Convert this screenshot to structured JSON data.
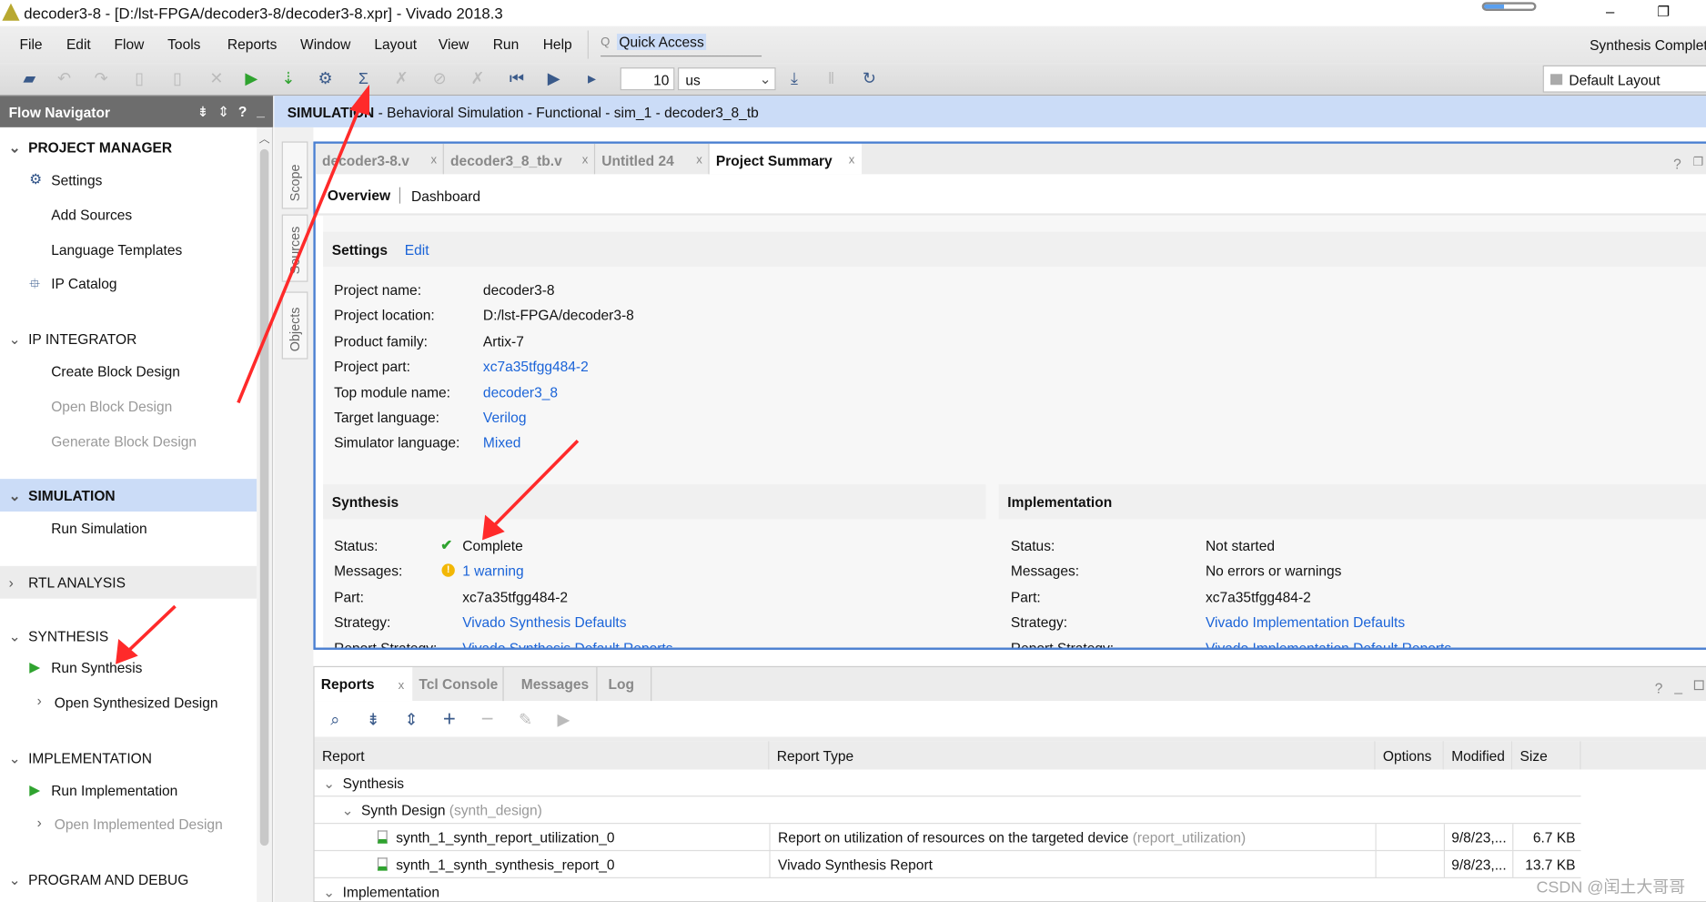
{
  "window": {
    "title": "decoder3-8 - [D:/lst-FPGA/decoder3-8/decoder3-8.xpr] - Vivado 2018.3",
    "minimize": "–",
    "restore": "❐"
  },
  "menu": [
    "File",
    "Edit",
    "Flow",
    "Tools",
    "Reports",
    "Window",
    "Layout",
    "View",
    "Run",
    "Help"
  ],
  "quick_access": "Quick Access",
  "status": "Synthesis Complete",
  "toolbar": {
    "time_value": "10",
    "time_unit": "us",
    "layout": "Default Layout"
  },
  "flow_navigator": {
    "title": "Flow Navigator",
    "sections": [
      {
        "label": "PROJECT MANAGER",
        "bold": true,
        "items": [
          {
            "label": "Settings",
            "icon": "gear-icon"
          },
          {
            "label": "Add Sources"
          },
          {
            "label": "Language Templates"
          },
          {
            "label": "IP Catalog",
            "icon": "ip-icon"
          }
        ]
      },
      {
        "label": "IP INTEGRATOR",
        "items": [
          {
            "label": "Create Block Design"
          },
          {
            "label": "Open Block Design",
            "disabled": true
          },
          {
            "label": "Generate Block Design",
            "disabled": true
          }
        ]
      },
      {
        "label": "SIMULATION",
        "bold": true,
        "selected": true,
        "items": [
          {
            "label": "Run Simulation"
          }
        ]
      },
      {
        "label": "RTL ANALYSIS",
        "collapsed": true
      },
      {
        "label": "SYNTHESIS",
        "items": [
          {
            "label": "Run Synthesis",
            "icon": "play-icon"
          },
          {
            "label": "Open Synthesized Design",
            "expandable": true
          }
        ]
      },
      {
        "label": "IMPLEMENTATION",
        "items": [
          {
            "label": "Run Implementation",
            "icon": "play-icon"
          },
          {
            "label": "Open Implemented Design",
            "expandable": true,
            "disabled": true
          }
        ]
      },
      {
        "label": "PROGRAM AND DEBUG"
      }
    ]
  },
  "sim_header": {
    "bold": "SIMULATION",
    "rest": " - Behavioral Simulation - Functional - sim_1 - decoder3_8_tb"
  },
  "side_tabs": [
    "Scope",
    "Sources",
    "Objects"
  ],
  "editor_tabs": [
    "decoder3-8.v",
    "decoder3_8_tb.v",
    "Untitled 24",
    "Project Summary"
  ],
  "summary": {
    "subtabs": [
      "Overview",
      "Dashboard"
    ],
    "settings": {
      "title": "Settings",
      "edit": "Edit",
      "rows": [
        {
          "label": "Project name:",
          "value": "decoder3-8"
        },
        {
          "label": "Project location:",
          "value": "D:/lst-FPGA/decoder3-8"
        },
        {
          "label": "Product family:",
          "value": "Artix-7"
        },
        {
          "label": "Project part:",
          "value": "xc7a35tfgg484-2",
          "link": true
        },
        {
          "label": "Top module name:",
          "value": "decoder3_8",
          "link": true
        },
        {
          "label": "Target language:",
          "value": "Verilog",
          "link": true
        },
        {
          "label": "Simulator language:",
          "value": "Mixed",
          "link": true
        }
      ]
    },
    "synthesis": {
      "title": "Synthesis",
      "rows": [
        {
          "label": "Status:",
          "value": "Complete",
          "icon": "check-icon"
        },
        {
          "label": "Messages:",
          "value": "1 warning",
          "icon": "warning-icon",
          "link": true
        },
        {
          "label": "Part:",
          "value": "xc7a35tfgg484-2"
        },
        {
          "label": "Strategy:",
          "value": "Vivado Synthesis Defaults",
          "link": true
        },
        {
          "label": "Report Strategy:",
          "value": "Vivado Synthesis Default Reports",
          "link": true
        }
      ]
    },
    "implementation": {
      "title": "Implementation",
      "rows": [
        {
          "label": "Status:",
          "value": "Not started"
        },
        {
          "label": "Messages:",
          "value": "No errors or warnings"
        },
        {
          "label": "Part:",
          "value": "xc7a35tfgg484-2"
        },
        {
          "label": "Strategy:",
          "value": "Vivado Implementation Defaults",
          "link": true
        },
        {
          "label": "Report Strategy:",
          "value": "Vivado Implementation Default Reports",
          "link": true
        }
      ]
    }
  },
  "bottom_tabs": [
    "Reports",
    "Tcl Console",
    "Messages",
    "Log"
  ],
  "reports": {
    "columns": [
      "Report",
      "Report Type",
      "Options",
      "Modified",
      "Size"
    ],
    "rows": [
      {
        "level": 0,
        "name": "Synthesis"
      },
      {
        "level": 1,
        "name": "Synth Design",
        "sub": "(synth_design)"
      },
      {
        "level": 2,
        "name": "synth_1_synth_report_utilization_0",
        "type": "Report on utilization of resources on the targeted device",
        "type_sub": "(report_utilization)",
        "modified": "9/8/23,...",
        "size": "6.7 KB"
      },
      {
        "level": 2,
        "name": "synth_1_synth_synthesis_report_0",
        "type": "Vivado Synthesis Report",
        "modified": "9/8/23,...",
        "size": "13.7 KB"
      },
      {
        "level": 0,
        "name": "Implementation"
      }
    ]
  },
  "watermark": "CSDN @闰土大哥哥",
  "colors": {
    "accent": "#1a63d8",
    "selection": "#cbdcf7",
    "panel_border": "#4a7fd1",
    "annotation": "#ff2a2a",
    "run": "#2fa32f"
  }
}
